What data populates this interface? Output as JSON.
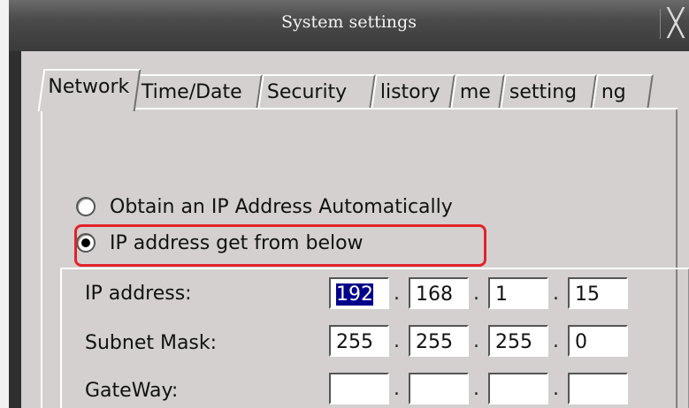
{
  "window": {
    "title": "System settings",
    "close_glyph": "╳"
  },
  "tabs": [
    {
      "label": "Network",
      "active": true
    },
    {
      "label": "Time/Date"
    },
    {
      "label": "Security"
    },
    {
      "label": "listory"
    },
    {
      "label": "me"
    },
    {
      "label": "setting"
    },
    {
      "label": "ng"
    }
  ],
  "network": {
    "options": [
      {
        "label": "Obtain an IP Address Automatically",
        "selected": false
      },
      {
        "label": "IP address get from below",
        "selected": true
      }
    ],
    "fields": [
      {
        "label": "IP address:",
        "octets": [
          "192",
          "168",
          "1",
          "15"
        ]
      },
      {
        "label": "Subnet Mask:",
        "octets": [
          "255",
          "255",
          "255",
          "0"
        ]
      },
      {
        "label": "GateWay:",
        "octets": [
          "",
          "",
          "",
          ""
        ]
      }
    ],
    "separator": "."
  },
  "colors": {
    "highlight": "#e0242a",
    "selection": "#00008b",
    "panel": "#d4d0d0"
  }
}
